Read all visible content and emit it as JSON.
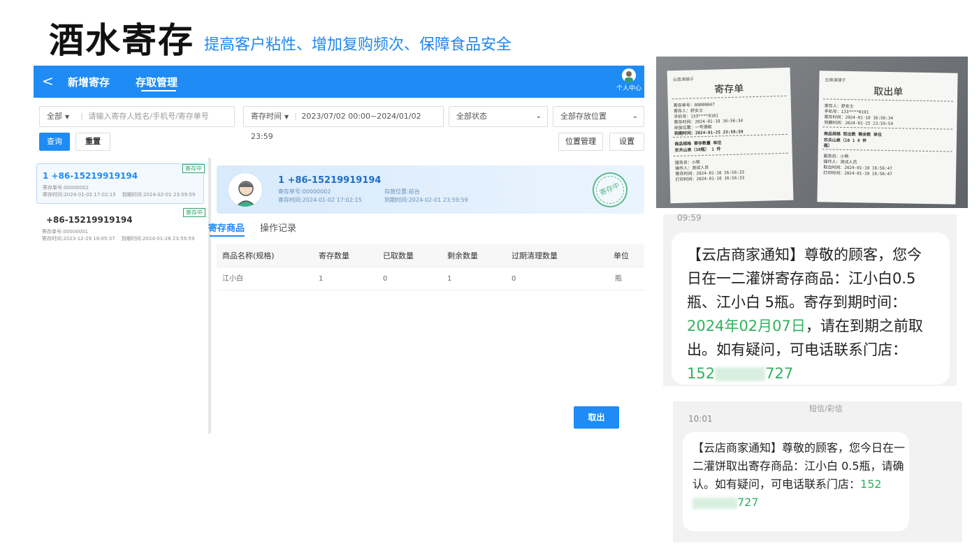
{
  "heading": {
    "title": "酒水寄存",
    "subtitle": "提高客户粘性、增加复购频次、保障食品安全"
  },
  "app": {
    "topbar": {
      "back": "<",
      "tab_new": "新增寄存",
      "tab_manage": "存取管理",
      "profile_label": "个人中心"
    },
    "filters": {
      "scope": "全部",
      "search_placeholder": "请输入寄存人姓名/手机号/寄存单号",
      "time_type": "寄存时间",
      "date_range": "2023/07/02 00:00~2024/01/02 23:59",
      "status": "全部状态",
      "location": "全部存放位置"
    },
    "actions": {
      "query": "查询",
      "reset": "重置",
      "location_manage": "位置管理",
      "settings": "设置"
    },
    "list": [
      {
        "phone": "1  +86-15219919194",
        "no": "寄存单号:00000002",
        "deposit_time": "寄存时间:2024-01-02 17:02:15",
        "expire_time": "到期时间:2024-02-01 23:59:59",
        "badge": "寄存中"
      },
      {
        "phone": "+86-15219919194",
        "no": "寄存单号:00000001",
        "deposit_time": "寄存时间:2023-12-29 18:05:37",
        "expire_time": "到期时间:2024-01-28 23:59:59",
        "badge": "寄存中"
      }
    ],
    "detail": {
      "phone": "1  +86-15219919194",
      "no": "寄存单号:00000002",
      "deposit_time": "寄存时间:2024-01-02 17:02:15",
      "location": "存放位置:前台",
      "expire_time": "到期时间:2024-02-01 23:59:59",
      "stamp": "寄存中",
      "tabs": [
        "寄存商品",
        "操作记录"
      ],
      "columns": [
        "商品名称(规格)",
        "寄存数量",
        "已取数量",
        "剩余数量",
        "过期清理数量",
        "单位"
      ],
      "rows": [
        [
          "江小白",
          "1",
          "0",
          "1",
          "0",
          "瓶"
        ]
      ],
      "take_button": "取出"
    }
  },
  "photo": {
    "receipt_left": {
      "shop": "云南滇铺子",
      "title": "寄存单",
      "lines": [
        "寄存单号：00000047",
        "寄存人：舒女士",
        "手机号：133****0101",
        "寄存时间：2024-01-10 16:56:34",
        "存放位置：一号酒柜",
        "到期时间：2024-01-25 23:59:59",
        "商品规格        寄存数量    单位",
        "农夫山泉（10瓶）       1        件",
        "服务员：小熊",
        "操作人：测试人员",
        "寄存时间：2024-01-10 16:56:33",
        "打印时间：2024-01-10 16:56:33"
      ]
    },
    "receipt_right": {
      "shop": "云南滇铺子",
      "title": "取出单",
      "lines": [
        "寄存人：舒女士",
        "手机号：133****0101",
        "寄存时间：2024-01-10 16:56:34",
        "到期时间：2024-01-25 23:59:59",
        "商品规格    取出数   剩余数   单位",
        "农夫山泉（10    1       0      件",
        "瓶）",
        "服务员：小熊",
        "操作人：测试人员",
        "取出时间：2024-01-10 16:56:47",
        "打印时间：2024-01-10 16:56:47"
      ]
    }
  },
  "sms1": {
    "time": "09:59",
    "text_a": "【云店商家通知】尊敬的顾客，您今日在一二灌饼寄存商品：江小白0.5瓶、江小白 5瓶。寄存到期时间：",
    "date": "2024年02月07日",
    "text_b": "，请在到期之前取出。如有疑问，可电话联系门店：",
    "phone_a": "152",
    "phone_b": "727"
  },
  "sms2": {
    "label": "短信/彩信",
    "time": "10:01",
    "text": "【云店商家通知】尊敬的顾客，您今日在一二灌饼取出寄存商品：江小白 0.5瓶，请确认。如有疑问，可电话联系门店：",
    "phone_a": "152",
    "phone_b": "727"
  }
}
